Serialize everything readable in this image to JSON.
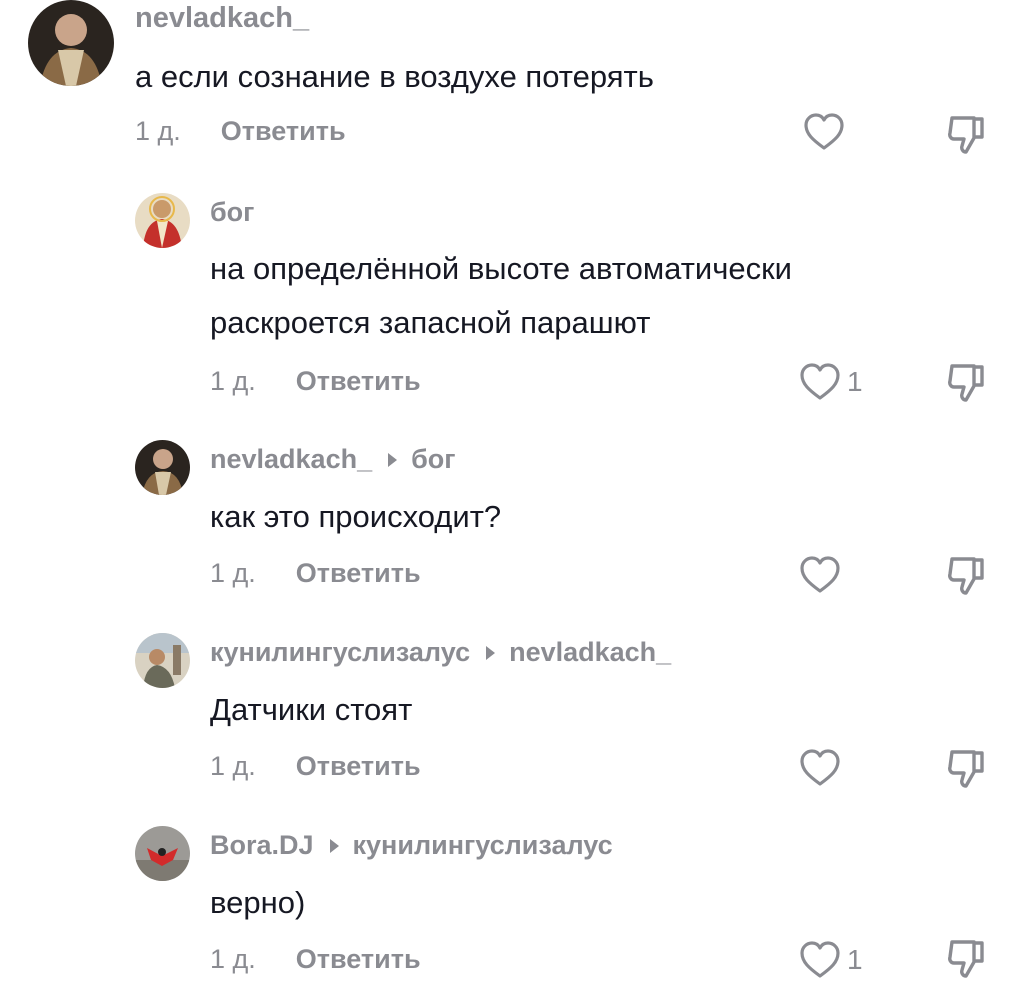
{
  "comments": [
    {
      "username": "nevladkach_",
      "reply_to": "",
      "lines": [
        "а если сознание в воздухе потерять"
      ],
      "time": "1 д.",
      "reply_label": "Ответить",
      "like_count": "",
      "avatar_icon": "user-avatar"
    },
    {
      "username": "бог",
      "reply_to": "",
      "lines": [
        "на определённой высоте автоматически",
        "раскроется запасной парашют"
      ],
      "time": "1 д.",
      "reply_label": "Ответить",
      "like_count": "1",
      "avatar_icon": "user-avatar"
    },
    {
      "username": "nevladkach_",
      "reply_to": "бог",
      "lines": [
        "как это происходит?"
      ],
      "time": "1 д.",
      "reply_label": "Ответить",
      "like_count": "",
      "avatar_icon": "user-avatar"
    },
    {
      "username": "кунилингуслизалус",
      "reply_to": "nevladkach_",
      "lines": [
        "Датчики стоят"
      ],
      "time": "1 д.",
      "reply_label": "Ответить",
      "like_count": "",
      "avatar_icon": "user-avatar"
    },
    {
      "username": "Bora.DJ",
      "reply_to": "кунилингуслизалус",
      "lines": [
        "верно)"
      ],
      "time": "1 д.",
      "reply_label": "Ответить",
      "like_count": "1",
      "avatar_icon": "user-avatar"
    }
  ],
  "icons": {
    "like": "heart-icon",
    "dislike": "thumbs-down-icon",
    "reply_arrow": "caret-right-icon"
  },
  "colors": {
    "text": "#161823",
    "muted": "#8a8b91",
    "background": "#ffffff"
  }
}
